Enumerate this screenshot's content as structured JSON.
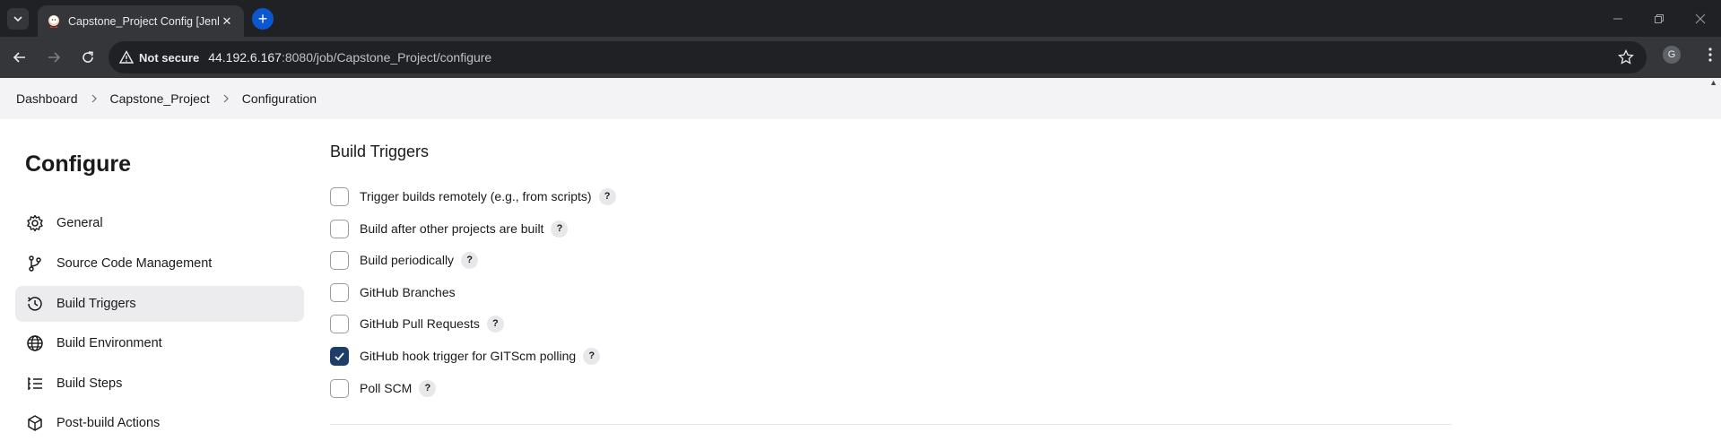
{
  "browser": {
    "tab_title": "Capstone_Project Config [Jenkins]",
    "security_label": "Not secure",
    "url_host": "44.192.6.167",
    "url_rest": ":8080/job/Capstone_Project/configure",
    "profile_initial": "G"
  },
  "breadcrumb": [
    "Dashboard",
    "Capstone_Project",
    "Configuration"
  ],
  "sidebar": {
    "title": "Configure",
    "items": [
      {
        "label": "General",
        "icon": "gear-icon"
      },
      {
        "label": "Source Code Management",
        "icon": "branch-icon"
      },
      {
        "label": "Build Triggers",
        "icon": "clock-icon",
        "active": true
      },
      {
        "label": "Build Environment",
        "icon": "globe-icon"
      },
      {
        "label": "Build Steps",
        "icon": "list-icon"
      },
      {
        "label": "Post-build Actions",
        "icon": "cube-icon"
      }
    ]
  },
  "main": {
    "section_title": "Build Triggers",
    "triggers": [
      {
        "label": "Trigger builds remotely (e.g., from scripts)",
        "checked": false,
        "help": "?"
      },
      {
        "label": "Build after other projects are built",
        "checked": false,
        "help": "?"
      },
      {
        "label": "Build periodically",
        "checked": false,
        "help": "?"
      },
      {
        "label": "GitHub Branches",
        "checked": false
      },
      {
        "label": "GitHub Pull Requests",
        "checked": false,
        "help": "?"
      },
      {
        "label": "GitHub hook trigger for GITScm polling",
        "checked": true,
        "help": "?"
      },
      {
        "label": "Poll SCM",
        "checked": false,
        "help": "?"
      }
    ]
  },
  "colors": {
    "checkbox_checked": "#1e3d6b",
    "active_sidebar": "#ececef"
  }
}
